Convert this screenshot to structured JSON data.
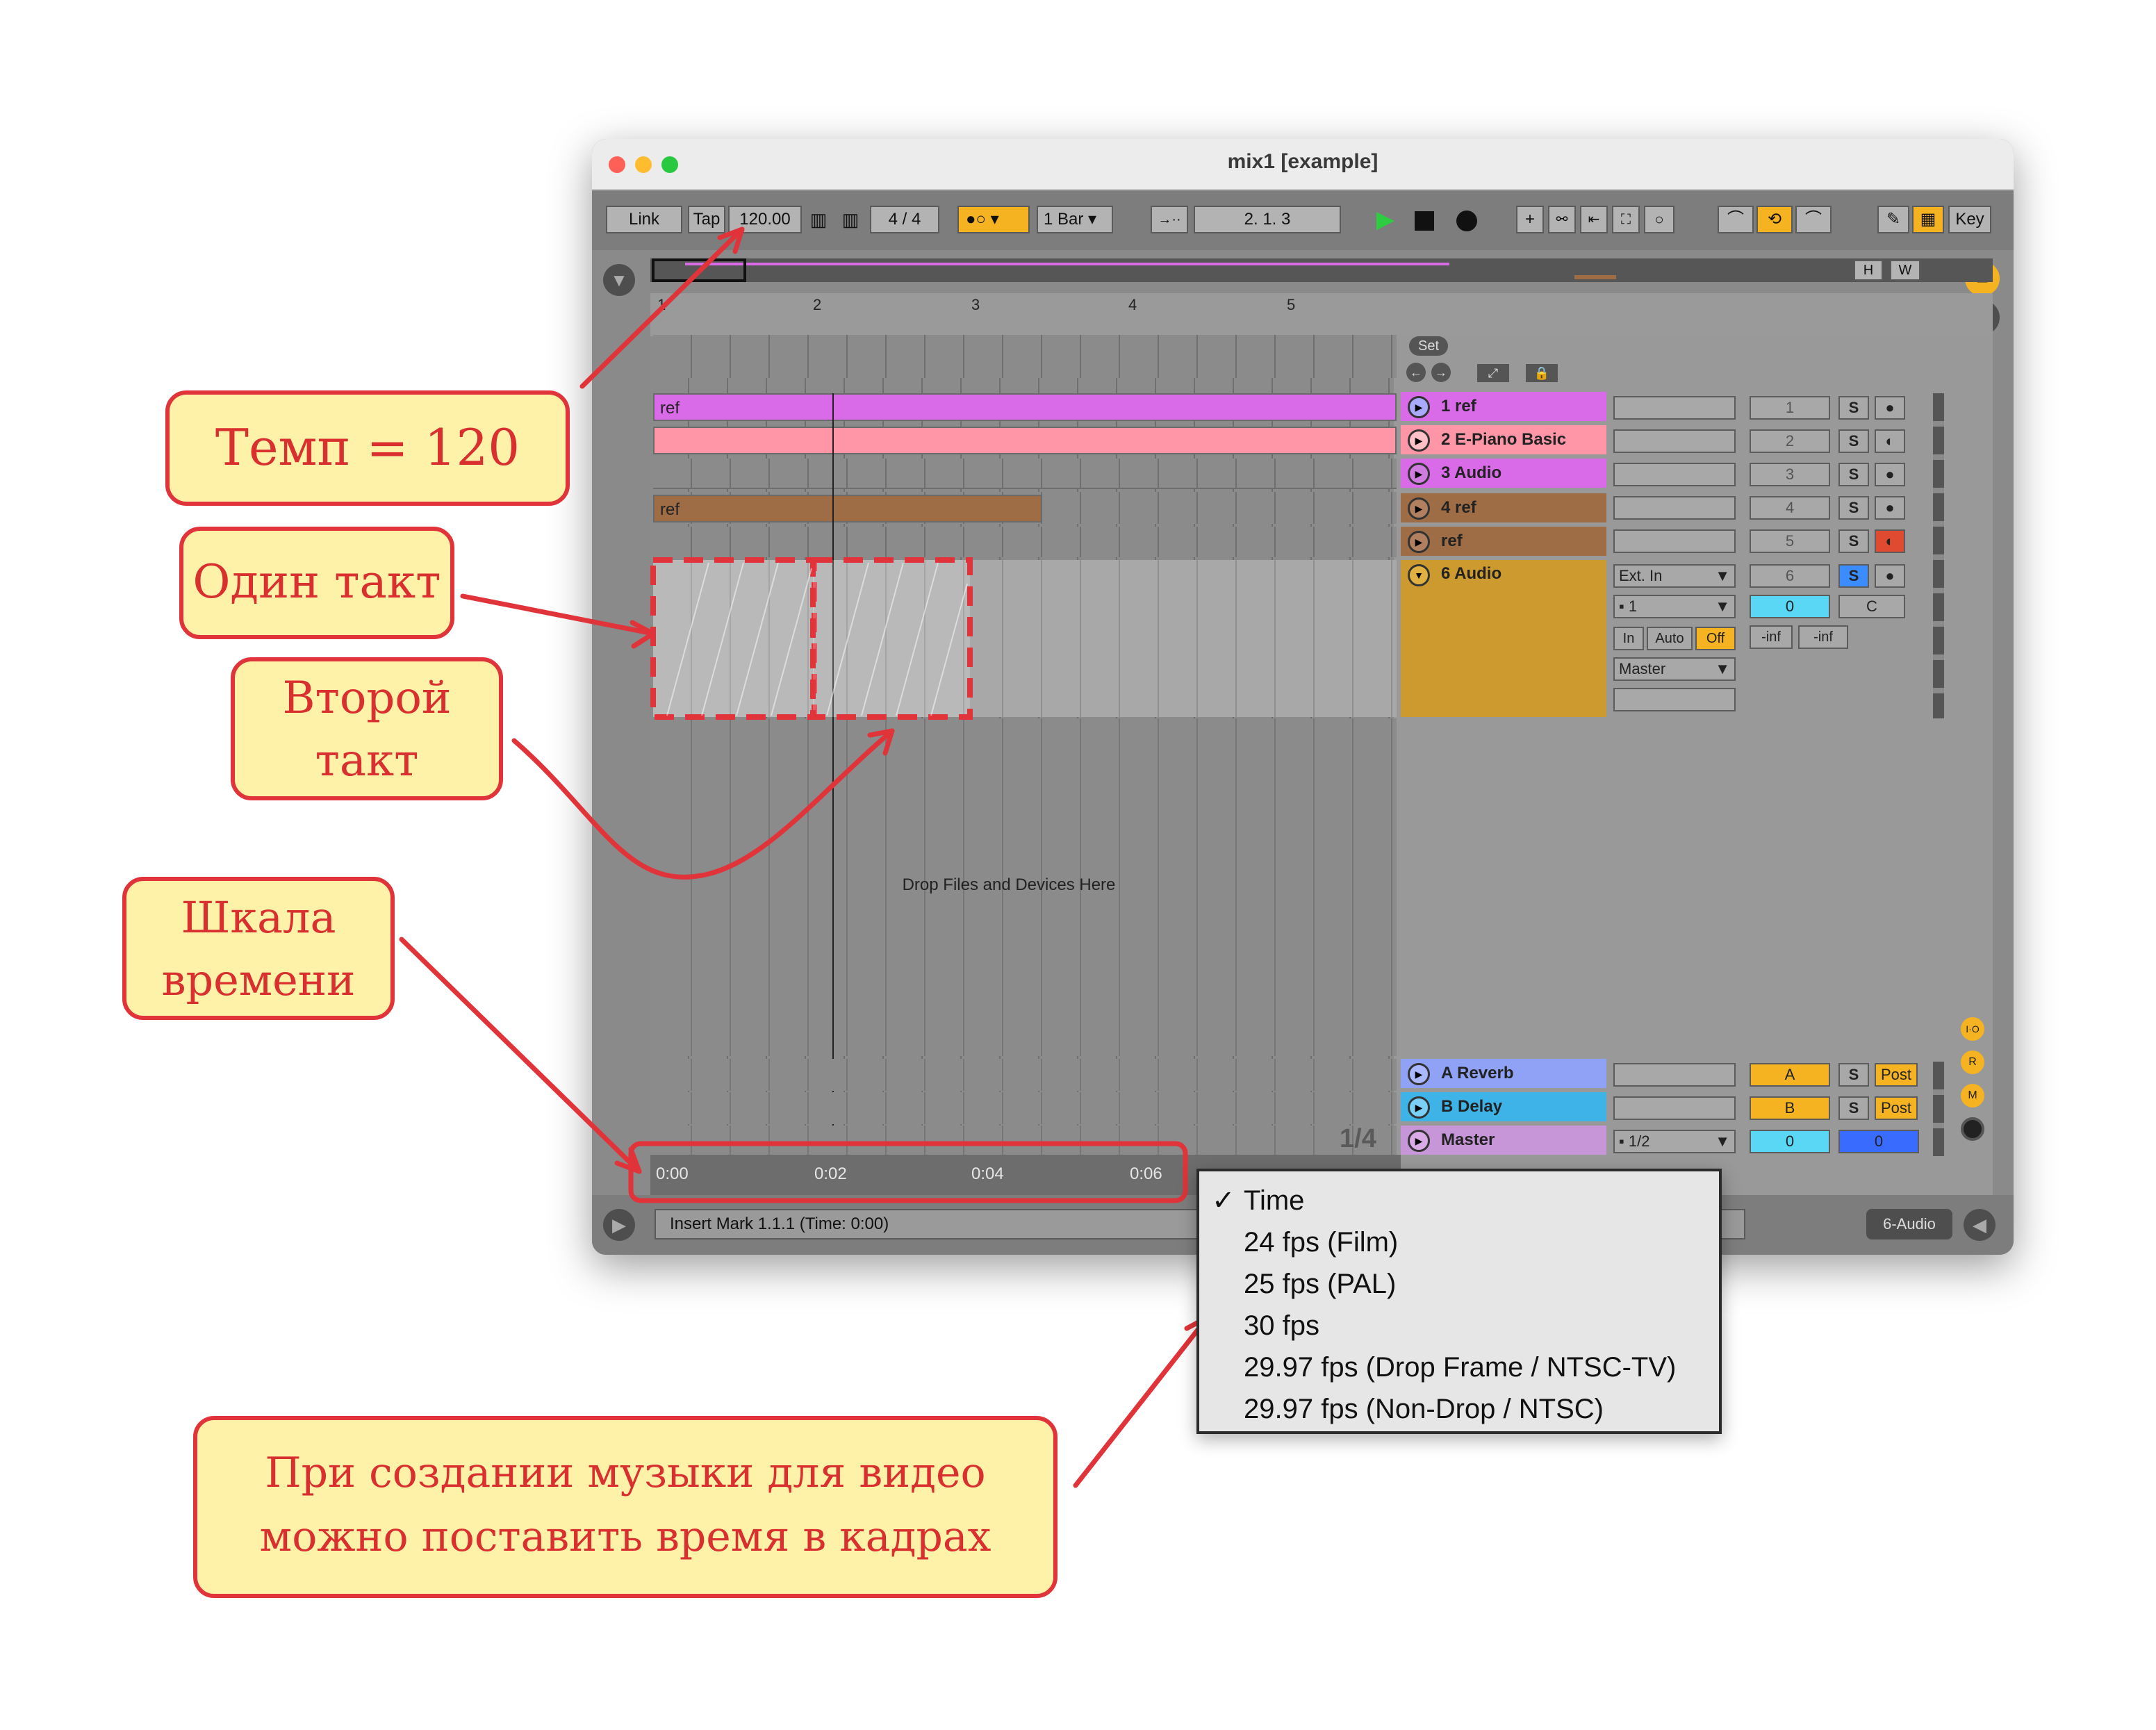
{
  "window": {
    "title": "mix1  [example]"
  },
  "control_bar": {
    "link": "Link",
    "tap": "Tap",
    "tempo": "120.00",
    "signature": "4  /  4",
    "quantize": "1 Bar",
    "position": "2.   1.   3",
    "key": "Key"
  },
  "overview": {
    "h": "H",
    "w": "W"
  },
  "ruler": {
    "bars": [
      "1",
      "2",
      "3",
      "4",
      "5"
    ]
  },
  "set_label": "Set",
  "tracks": [
    {
      "name": "1 ref",
      "number": "1",
      "color": "#d96be8",
      "clip": "ref"
    },
    {
      "name": "2 E-Piano Basic",
      "number": "2",
      "color": "#ff96a8",
      "clip": ""
    },
    {
      "name": "3 Audio",
      "number": "3",
      "color": "#d96be8",
      "clip": ""
    },
    {
      "name": "4 ref",
      "number": "4",
      "color": "#9e6d45",
      "clip": "ref"
    },
    {
      "name": "ref",
      "number": "5",
      "color": "#9e6d45",
      "clip": ""
    },
    {
      "name": "6 Audio",
      "number": "6",
      "color": "#cc9a2e",
      "clip": ""
    }
  ],
  "audio_track": {
    "input_type": "Ext. In",
    "input_channel": "1",
    "monitor": [
      "In",
      "Auto",
      "Off"
    ],
    "output": "Master",
    "volume": "0",
    "pan": "C",
    "peak_left": "-inf",
    "peak_right": "-inf"
  },
  "solo_label": "S",
  "drop_hint": "Drop Files and Devices Here",
  "returns": [
    {
      "name": "A Reverb",
      "letter": "A",
      "post": "Post",
      "color": "#8fa2f5"
    },
    {
      "name": "B Delay",
      "letter": "B",
      "post": "Post",
      "color": "#3db3e8"
    }
  ],
  "master": {
    "name": "Master",
    "cue": "1/2",
    "volume": "0",
    "pan": "0",
    "grid": "1/4"
  },
  "side_buttons": [
    "I·O",
    "R",
    "M"
  ],
  "time_ruler": [
    "0:00",
    "0:02",
    "0:04",
    "0:06"
  ],
  "status_bar": {
    "text": "Insert Mark 1.1.1 (Time: 0:00)",
    "track": "6-Audio"
  },
  "dropdown": {
    "items": [
      "Time",
      "24 fps (Film)",
      "25 fps (PAL)",
      "30 fps",
      "29.97 fps (Drop Frame / NTSC-TV)",
      "29.97 fps (Non-Drop / NTSC)"
    ],
    "checked": "Time"
  },
  "annotations": {
    "tempo": "Темп = 120",
    "one_bar": "Один такт",
    "second_bar_1": "Второй",
    "second_bar_2": "такт",
    "timeline_1": "Шкала",
    "timeline_2": "времени",
    "video_1": "При создании музыки для видео",
    "video_2": "можно поставить время в кадрах"
  }
}
